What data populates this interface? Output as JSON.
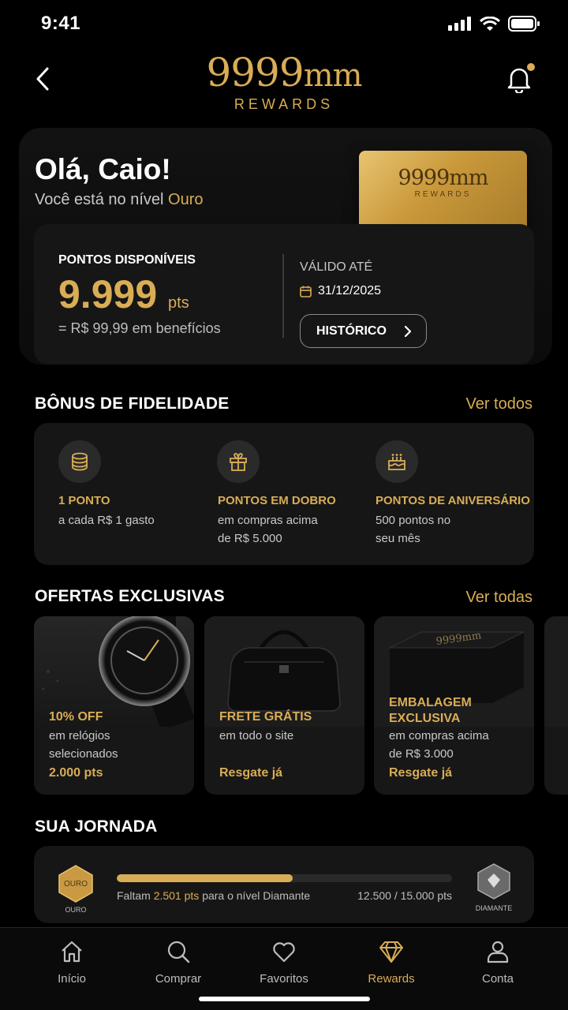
{
  "status": {
    "time": "9:41"
  },
  "brand": {
    "mark": "9999",
    "mark_suffix": "mm",
    "sub": "REWARDS",
    "accent": "#d9ad56"
  },
  "hero": {
    "greeting": "Olá, Caio!",
    "level_prefix": "Você está no nível",
    "level": "Ouro",
    "card_mark": "9999mm",
    "card_sub": "REWARDS"
  },
  "points": {
    "label": "PONTOS DISPONÍVEIS",
    "value": "9.999",
    "unit": "pts",
    "equivalent": "= R$ 99,99 em benefícios",
    "valid_label": "VÁLIDO ATÉ",
    "valid_date": "31/12/2025",
    "history_button": "HISTÓRICO"
  },
  "bonus": {
    "title": "BÔNUS DE FIDELIDADE",
    "see_all": "Ver todos",
    "items": [
      {
        "icon": "coins-icon",
        "title": "1 PONTO",
        "line1": "a cada R$ 1 gasto",
        "line2": ""
      },
      {
        "icon": "gift-icon",
        "title": "PONTOS EM DOBRO",
        "line1": "em compras acima",
        "line2": "de R$ 5.000"
      },
      {
        "icon": "cake-icon",
        "title": "PONTOS DE ANIVERSÁRIO",
        "line1": "500 pontos no",
        "line2": "seu mês"
      }
    ]
  },
  "offers": {
    "title": "OFERTAS EXCLUSIVAS",
    "see_all": "Ver todas",
    "items": [
      {
        "title": "10% OFF",
        "line1": "em relógios",
        "line2": "selecionados",
        "action": "2.000 pts"
      },
      {
        "title": "FRETE GRÁTIS",
        "line1": "em todo o site",
        "line2": "",
        "action": "Resgate já"
      },
      {
        "title_line1": "EMBALAGEM",
        "title_line2": "EXCLUSIVA",
        "line1": "em compras acima",
        "line2": "de R$ 3.000",
        "action": "Resgate já",
        "box_mark": "9999mm"
      }
    ]
  },
  "journey": {
    "title": "SUA JORNADA",
    "from_badge": "OURO",
    "from_label": "OURO",
    "to_label": "DIAMANTE",
    "remaining_prefix": "Faltam",
    "remaining": "2.501 pts",
    "remaining_suffix": "para o nível Diamante",
    "progress_text": "12.500 / 15.000 pts",
    "progress_fraction": 0.524
  },
  "tabs": [
    {
      "label": "Início",
      "icon": "home-icon"
    },
    {
      "label": "Comprar",
      "icon": "search-icon"
    },
    {
      "label": "Favoritos",
      "icon": "heart-icon"
    },
    {
      "label": "Rewards",
      "icon": "diamond-icon",
      "active": true
    },
    {
      "label": "Conta",
      "icon": "user-icon"
    }
  ]
}
